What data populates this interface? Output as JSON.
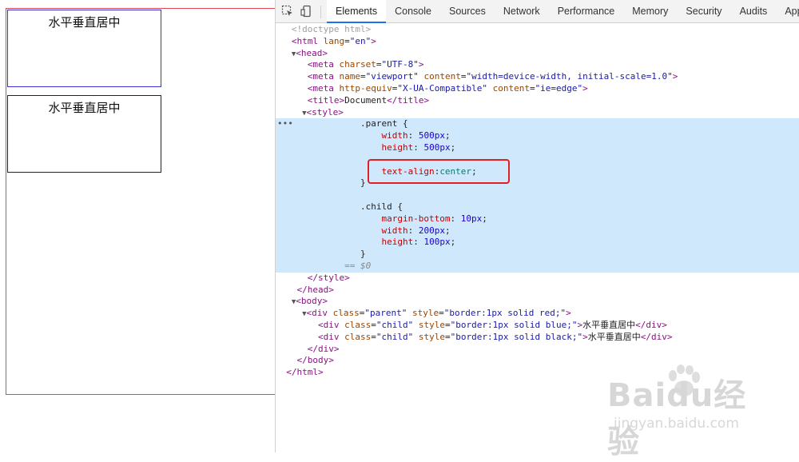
{
  "preview": {
    "child1_text": "水平垂直居中",
    "child2_text": "水平垂直居中"
  },
  "toolbar": {
    "tabs": [
      "Elements",
      "Console",
      "Sources",
      "Network",
      "Performance",
      "Memory",
      "Security",
      "Audits",
      "Applicatio"
    ],
    "active_tab": "Elements"
  },
  "code": {
    "doctype": "<!doctype html>",
    "html_open_tag": "<html",
    "html_lang_attr": "lang",
    "html_lang_val": "\"en\"",
    "head_open": "<head>",
    "meta1": {
      "tag": "<meta",
      "attr": "charset",
      "val": "\"UTF-8\""
    },
    "meta2": {
      "tag": "<meta",
      "attr1": "name",
      "val1": "\"viewport\"",
      "attr2": "content",
      "val2": "\"width=device-width, initial-scale=1.0\""
    },
    "meta3": {
      "tag": "<meta",
      "attr1": "http-equiv",
      "val1": "\"X-UA-Compatible\"",
      "attr2": "content",
      "val2": "\"ie=edge\""
    },
    "title": {
      "open": "<title>",
      "text": "Document",
      "close": "</title>"
    },
    "style_open": "<style>",
    "css_parent_selector": ".parent {",
    "css_parent_width_prop": "width",
    "css_parent_width_val": "500px",
    "css_parent_height_prop": "height",
    "css_parent_height_val": "500px",
    "css_text_align_prop": "text-align",
    "css_text_align_val": "center",
    "css_close": "}",
    "css_child_selector": ".child {",
    "css_child_mb_prop": "margin-bottom",
    "css_child_mb_val": "10px",
    "css_child_width_prop": "width",
    "css_child_width_val": "200px",
    "css_child_height_prop": "height",
    "css_child_height_val": "100px",
    "selected_marker": "== $0",
    "style_close": "</style>",
    "head_close": "</head>",
    "body_open": "<body>",
    "div_parent": {
      "tag": "<div",
      "class_attr": "class",
      "class_val": "\"parent\"",
      "style_attr": "style",
      "style_val": "\"border:1px solid red;\""
    },
    "div_child1": {
      "tag": "<div",
      "class_attr": "class",
      "class_val": "\"child\"",
      "style_attr": "style",
      "style_val": "\"border:1px solid blue;\"",
      "text": "水平垂直居中",
      "close": "</div>"
    },
    "div_child2": {
      "tag": "<div",
      "class_attr": "class",
      "class_val": "\"child\"",
      "style_attr": "style",
      "style_val": "\"border:1px solid black;\"",
      "text": "水平垂直居中",
      "close": "</div>"
    },
    "div_close": "</div>",
    "body_close": "</body>",
    "html_close": "</html>",
    "ellipsis": "•••"
  },
  "watermark": {
    "logo": "Baidu经验",
    "url": "jingyan.baidu.com"
  }
}
